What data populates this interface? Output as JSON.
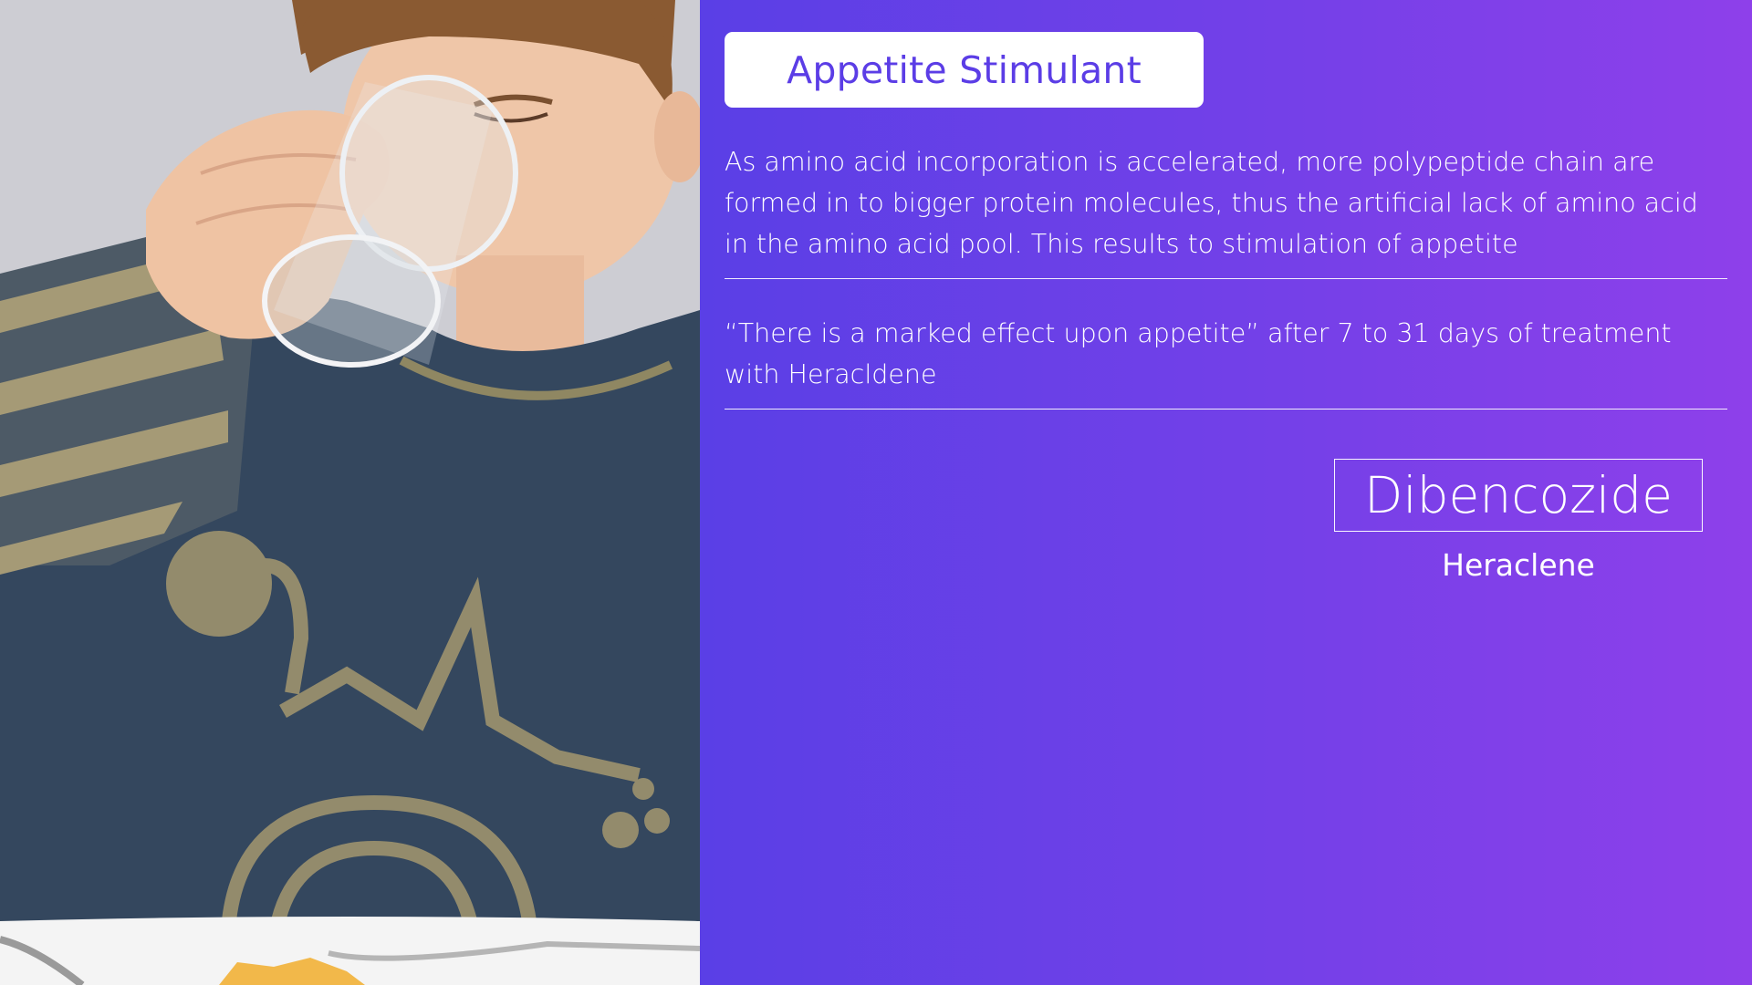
{
  "slide": {
    "title": "Appetite Stimulant",
    "paragraph_1": "As amino acid incorporation is accelerated, more polypeptide chain are formed in to bigger protein molecules, thus the artificial lack of amino acid in the amino acid pool. This results to stimulation of appetite",
    "paragraph_2": "“There is a marked effect upon appetite” after 7 to 31 days of treatment with Heracldene",
    "drug_name": "Dibencozide",
    "brand_name": "Heraclene"
  },
  "colors": {
    "panel_gradient_start": "#5a3fe6",
    "panel_gradient_end": "#8e40ea",
    "title_text": "#5b3de6",
    "text": "#ffffff"
  }
}
